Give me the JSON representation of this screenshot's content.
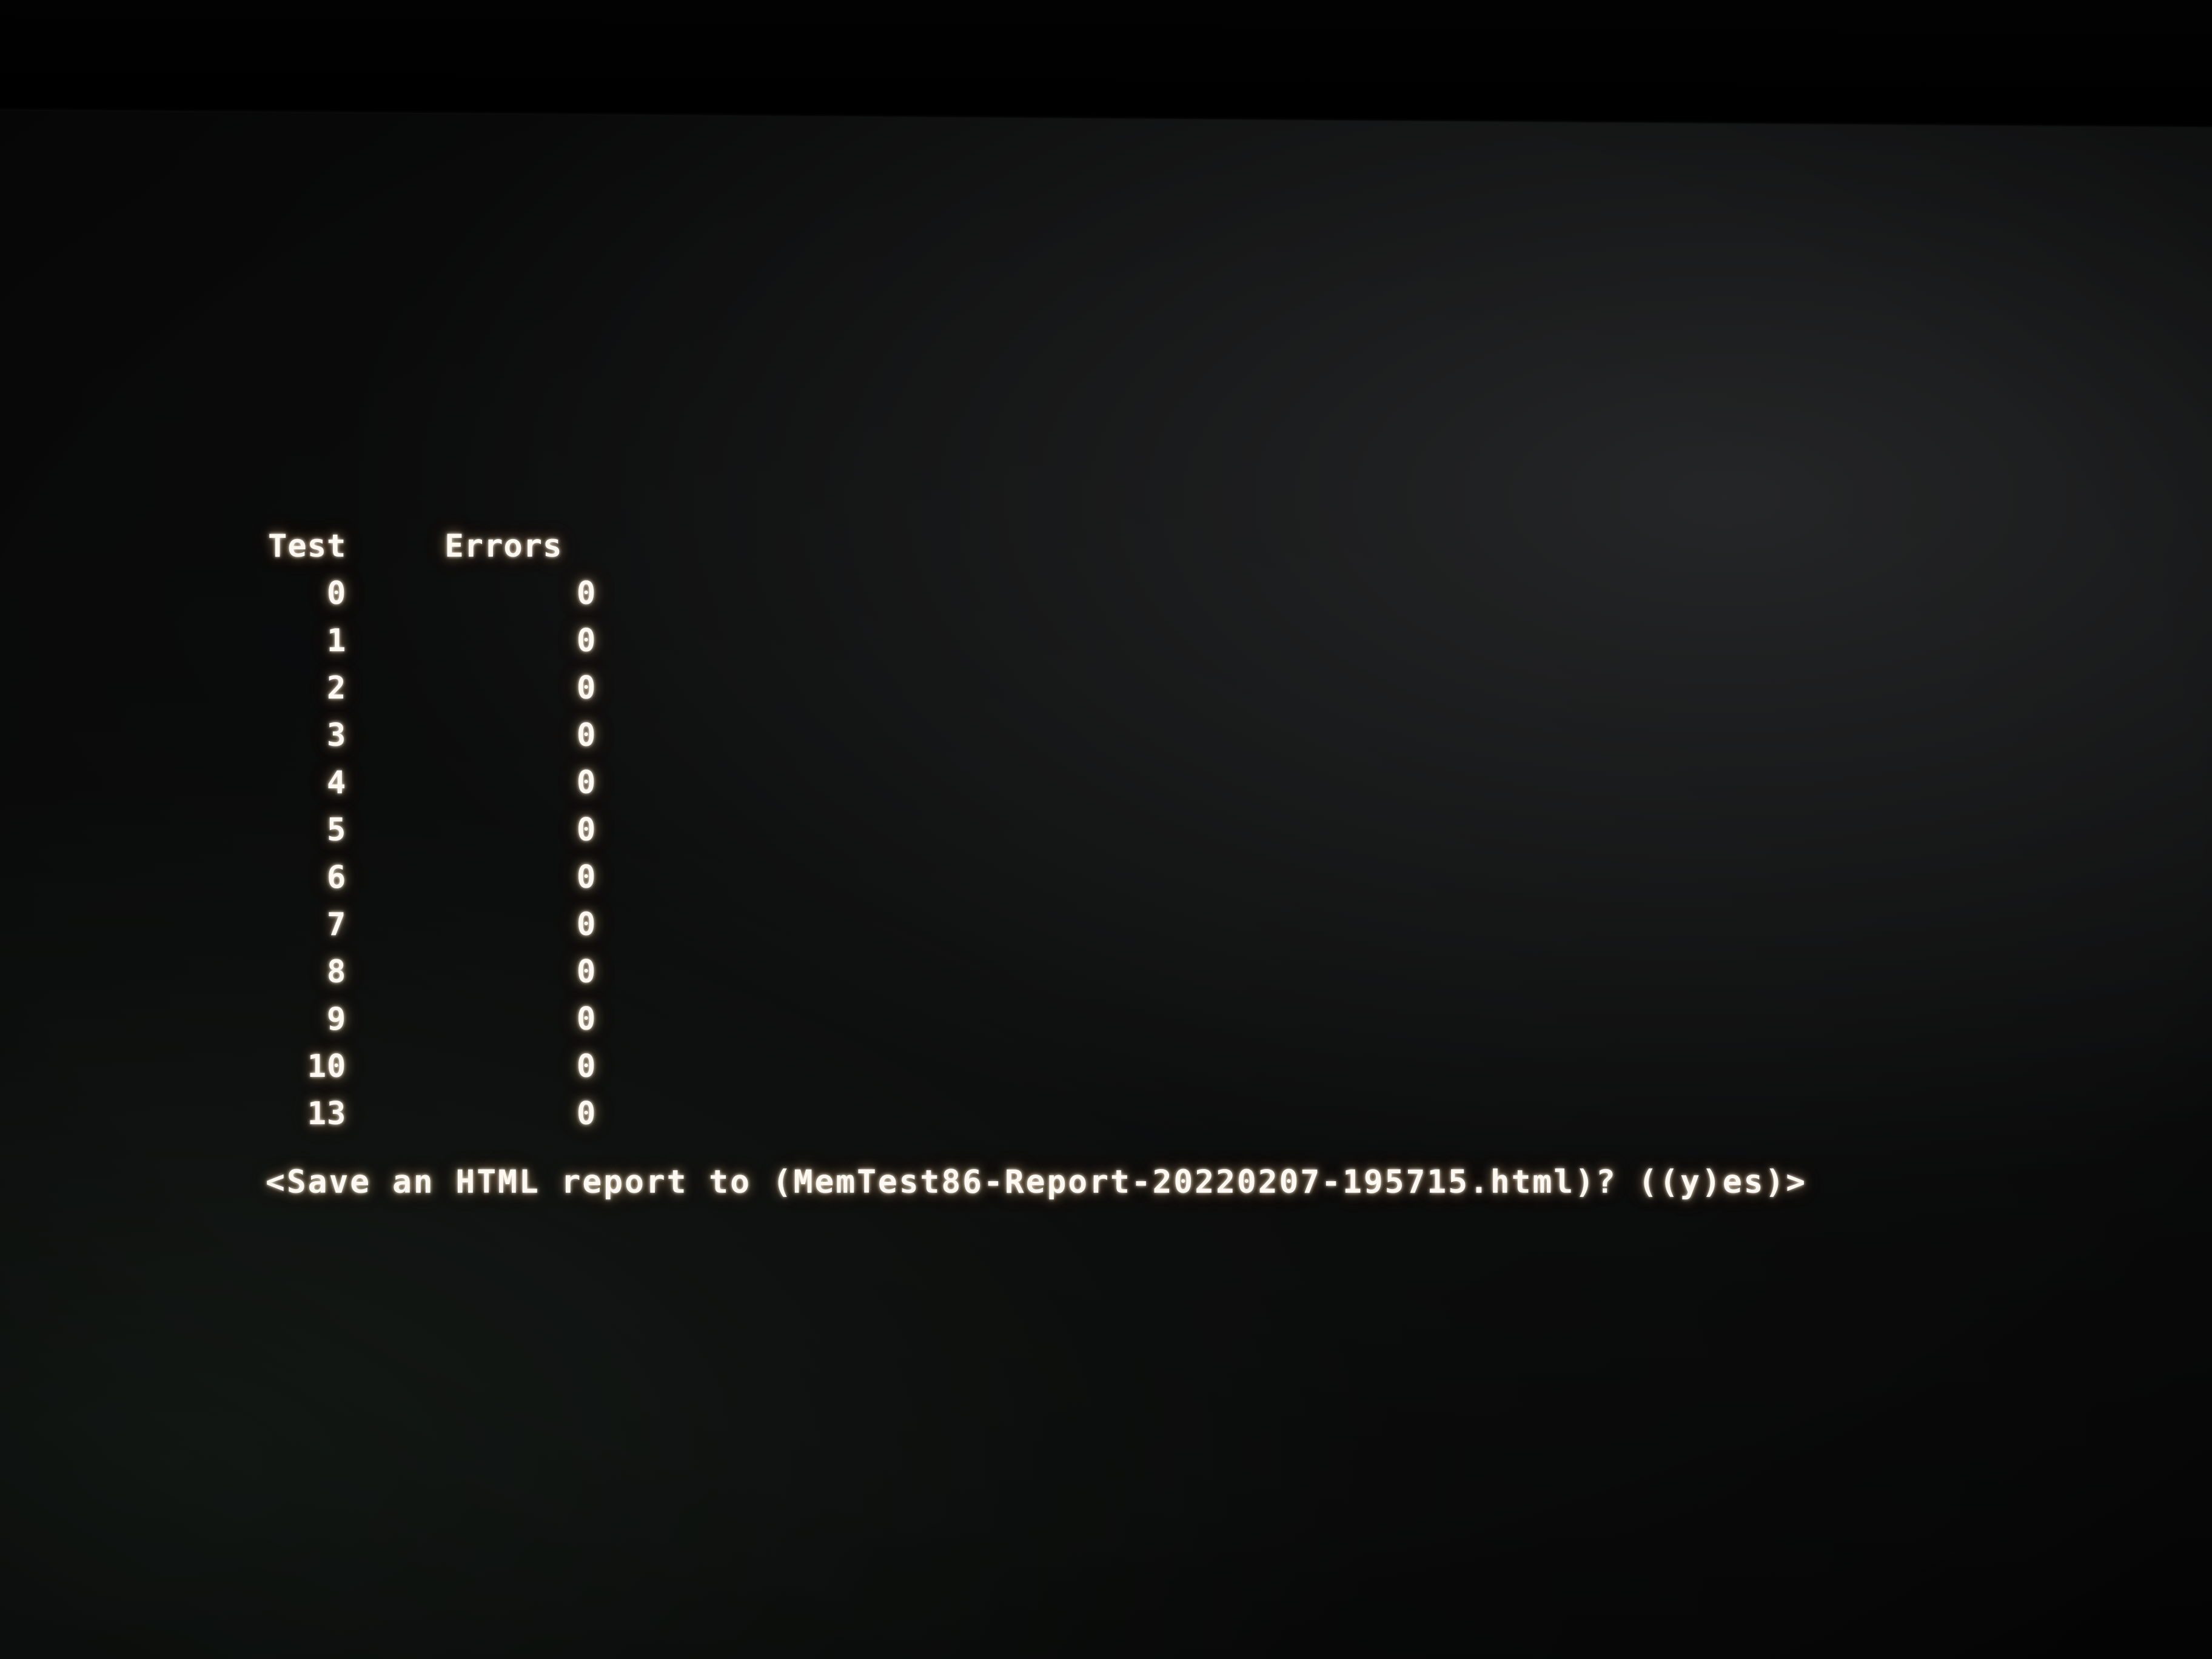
{
  "app": {
    "name": "MemTest86",
    "screen": "test-results"
  },
  "results": {
    "headers": {
      "test": "Test",
      "errors": "Errors"
    },
    "rows": [
      {
        "test": "0",
        "errors": "0"
      },
      {
        "test": "1",
        "errors": "0"
      },
      {
        "test": "2",
        "errors": "0"
      },
      {
        "test": "3",
        "errors": "0"
      },
      {
        "test": "4",
        "errors": "0"
      },
      {
        "test": "5",
        "errors": "0"
      },
      {
        "test": "6",
        "errors": "0"
      },
      {
        "test": "7",
        "errors": "0"
      },
      {
        "test": "8",
        "errors": "0"
      },
      {
        "test": "9",
        "errors": "0"
      },
      {
        "test": "10",
        "errors": "0"
      },
      {
        "test": "13",
        "errors": "0"
      }
    ]
  },
  "prompt": {
    "full_text": "<Save an HTML report to (MemTest86-Report-20220207-195715.html)? ((y)es)>",
    "question": "Save an HTML report to",
    "filename": "MemTest86-Report-20220207-195715.html",
    "options": "((y)es)"
  },
  "colors": {
    "text": "#fdf9f2",
    "background": "#000000",
    "glow": "#ffd6a0"
  }
}
